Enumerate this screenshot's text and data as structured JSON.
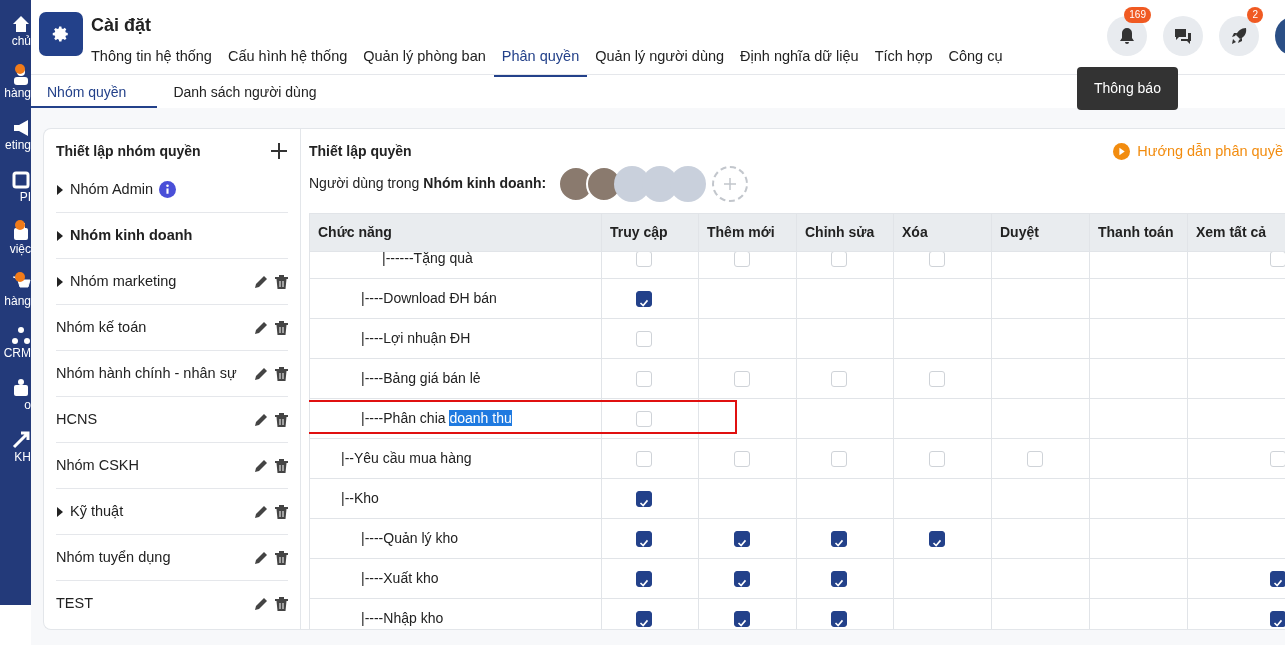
{
  "sidebar": {
    "items": [
      {
        "label": "chủ",
        "dot": false
      },
      {
        "label": "hàng",
        "dot": true
      },
      {
        "label": "eting",
        "dot": false
      },
      {
        "label": "PI",
        "dot": false
      },
      {
        "label": "việc",
        "dot": true
      },
      {
        "label": "hàng",
        "dot": true
      },
      {
        "label": "CRM",
        "dot": false
      },
      {
        "label": "o",
        "dot": false
      },
      {
        "label": "KH",
        "dot": false
      }
    ]
  },
  "header": {
    "title": "Cài đặt",
    "tabs": [
      {
        "label": "Thông tin hệ thống",
        "selected": false
      },
      {
        "label": "Cấu hình hệ thống",
        "selected": false
      },
      {
        "label": "Quản lý phòng ban",
        "selected": false
      },
      {
        "label": "Phân quyền",
        "selected": true
      },
      {
        "label": "Quản lý người dùng",
        "selected": false
      },
      {
        "label": "Định nghĩa dữ liệu",
        "selected": false
      },
      {
        "label": "Tích hợp",
        "selected": false
      },
      {
        "label": "Công cụ",
        "selected": false
      }
    ],
    "actions": [
      {
        "kind": "bell",
        "badge": "169"
      },
      {
        "kind": "chat"
      },
      {
        "kind": "rocket",
        "badge": "2"
      }
    ],
    "tooltip": "Thông báo"
  },
  "subtabs": [
    {
      "label": "Nhóm quyền",
      "selected": true
    },
    {
      "label": "Danh sách người dùng",
      "selected": false
    }
  ],
  "groups_panel": {
    "title": "Thiết lập nhóm quyền",
    "groups": [
      {
        "name": "Nhóm Admin",
        "expandable": true,
        "selected": false,
        "info": true,
        "editable": false
      },
      {
        "name": "Nhóm kinh doanh",
        "expandable": true,
        "selected": true,
        "info": false,
        "editable": false
      },
      {
        "name": "Nhóm marketing",
        "expandable": true,
        "selected": false,
        "info": false,
        "editable": true
      },
      {
        "name": "Nhóm kế toán",
        "expandable": false,
        "selected": false,
        "info": false,
        "editable": true
      },
      {
        "name": "Nhóm hành chính - nhân sự",
        "expandable": false,
        "selected": false,
        "info": false,
        "editable": true
      },
      {
        "name": "HCNS",
        "expandable": false,
        "selected": false,
        "info": false,
        "editable": true
      },
      {
        "name": "Nhóm CSKH",
        "expandable": false,
        "selected": false,
        "info": false,
        "editable": true
      },
      {
        "name": "Kỹ thuật",
        "expandable": true,
        "selected": false,
        "info": false,
        "editable": true
      },
      {
        "name": "Nhóm tuyển dụng",
        "expandable": false,
        "selected": false,
        "info": false,
        "editable": true
      },
      {
        "name": "TEST",
        "expandable": false,
        "selected": false,
        "info": false,
        "editable": true
      }
    ]
  },
  "permissions": {
    "title": "Thiết lập quyền",
    "users_label": "Người dùng trong **Nhóm kinh doanh:**",
    "members": [
      {
        "kind": "photo"
      },
      {
        "kind": "photo"
      },
      {
        "kind": "placeholder"
      },
      {
        "kind": "placeholder"
      },
      {
        "kind": "placeholder"
      },
      {
        "kind": "add"
      }
    ],
    "guide_link": "Hướng dẫn phân quyề",
    "table": {
      "columns": [
        "Chức năng",
        "Truy cập",
        "Thêm mới",
        "Chỉnh sửa",
        "Xóa",
        "Duyệt",
        "Thanh toán",
        "Xem tất cả"
      ],
      "rows": [
        {
          "label": "|------Tặng quà",
          "kind": "grandchild",
          "highlighted": false,
          "cells": [
            false,
            false,
            false,
            false,
            null,
            null,
            false
          ]
        },
        {
          "label": "|----Download ĐH bán",
          "kind": "child",
          "highlighted": false,
          "cells": [
            true,
            null,
            null,
            null,
            null,
            null,
            null
          ]
        },
        {
          "label": "|----Lợi nhuận ĐH",
          "kind": "child",
          "highlighted": false,
          "cells": [
            false,
            null,
            null,
            null,
            null,
            null,
            null
          ]
        },
        {
          "label": "|----Bảng giá bán lẻ",
          "kind": "child",
          "highlighted": false,
          "cells": [
            false,
            false,
            false,
            false,
            null,
            null,
            null
          ]
        },
        {
          "label": "|----Phân chia",
          "selected_text": "doanh thu",
          "kind": "child",
          "highlighted": true,
          "cells": [
            false,
            null,
            null,
            null,
            null,
            null,
            null
          ]
        },
        {
          "label": "|--Yêu cầu mua hàng",
          "kind": "parent",
          "highlighted": false,
          "cells": [
            false,
            false,
            false,
            false,
            false,
            null,
            false
          ]
        },
        {
          "label": "|--Kho",
          "kind": "parent",
          "highlighted": false,
          "cells": [
            true,
            null,
            null,
            null,
            null,
            null,
            null
          ]
        },
        {
          "label": "|----Quản lý kho",
          "kind": "child",
          "highlighted": false,
          "cells": [
            true,
            true,
            true,
            true,
            null,
            null,
            null
          ]
        },
        {
          "label": "|----Xuất kho",
          "kind": "child",
          "highlighted": false,
          "cells": [
            true,
            true,
            true,
            null,
            null,
            null,
            true
          ]
        },
        {
          "label": "|----Nhập kho",
          "kind": "child",
          "highlighted": false,
          "cells": [
            true,
            true,
            true,
            null,
            null,
            null,
            true
          ]
        }
      ]
    }
  }
}
